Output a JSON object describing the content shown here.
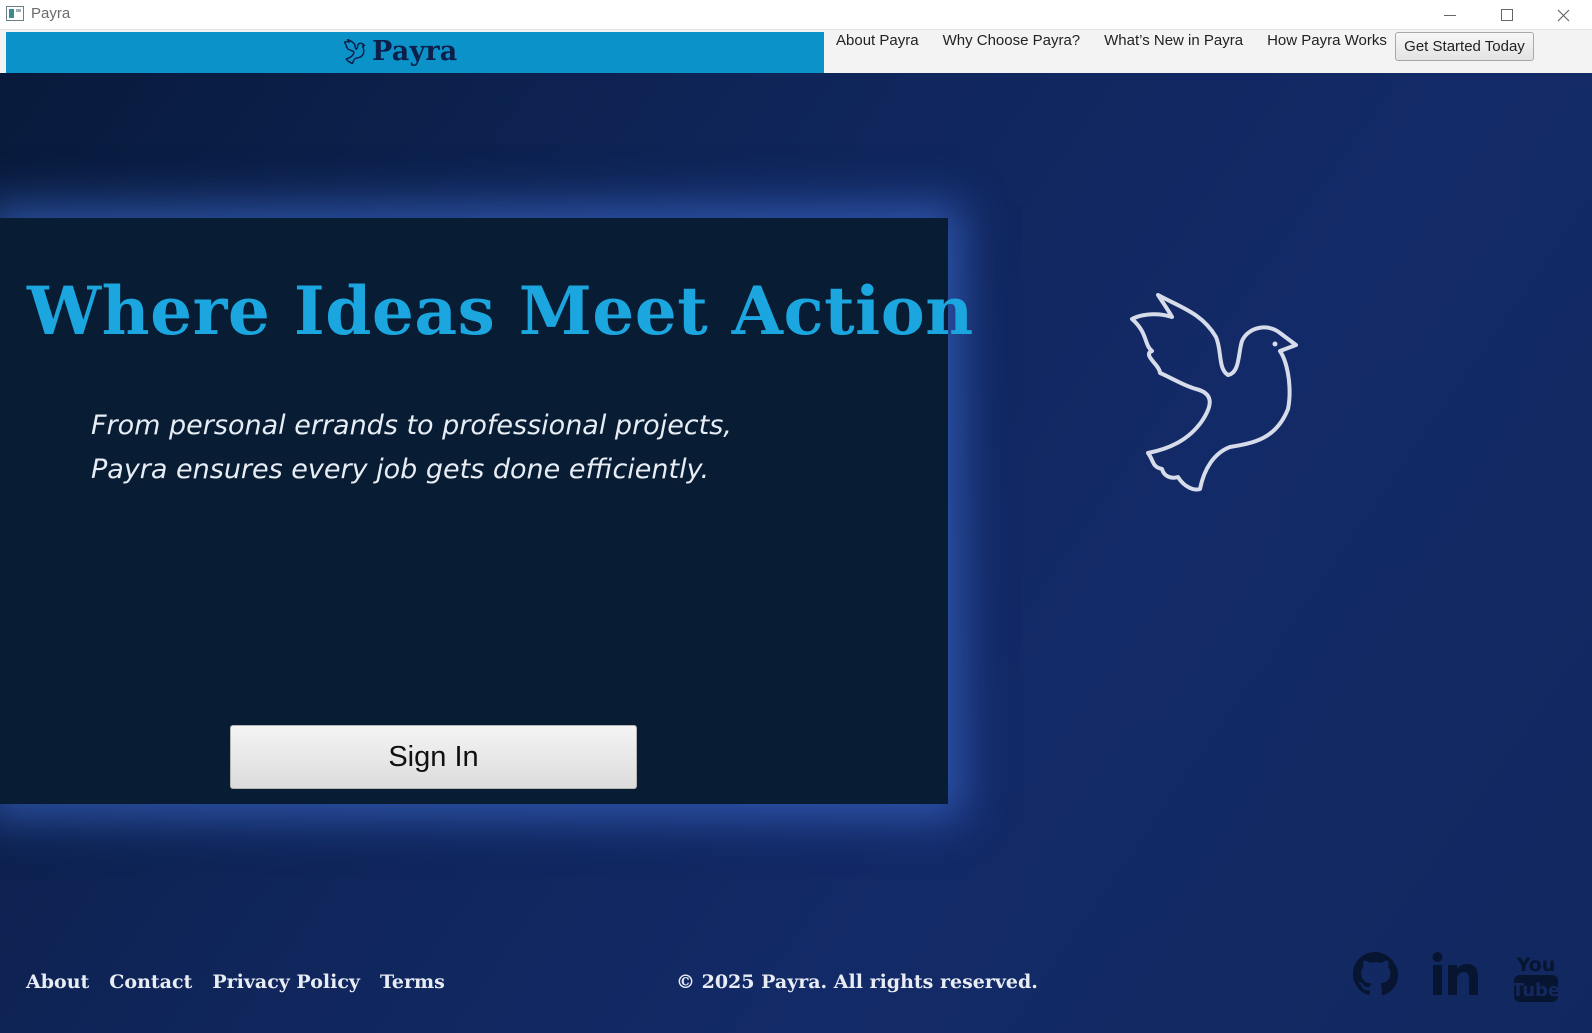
{
  "window": {
    "title": "Payra"
  },
  "header": {
    "brand_name": "Payra",
    "nav": [
      {
        "label": "About Payra"
      },
      {
        "label": "Why Choose Payra?"
      },
      {
        "label": "What’s New in Payra"
      },
      {
        "label": "How Payra Works"
      }
    ],
    "cta_label": "Get Started Today"
  },
  "hero": {
    "title": "Where Ideas Meet Action",
    "subtitle_line1": "From personal errands to professional projects,",
    "subtitle_line2": "Payra ensures every job gets done efficiently.",
    "signin_label": "Sign In"
  },
  "footer": {
    "links": [
      {
        "label": "About"
      },
      {
        "label": "Contact"
      },
      {
        "label": "Privacy Policy"
      },
      {
        "label": "Terms"
      }
    ],
    "copyright": "© 2025 Payra. All rights reserved.",
    "social": [
      "github-icon",
      "linkedin-icon",
      "youtube-icon"
    ],
    "youtube_icon_text": [
      "You",
      "Tube"
    ]
  },
  "colors": {
    "brand_band": "#0b93c9",
    "title_blue": "#1ba6df",
    "card_bg": "#081c33",
    "page_bg": "#12285f"
  }
}
